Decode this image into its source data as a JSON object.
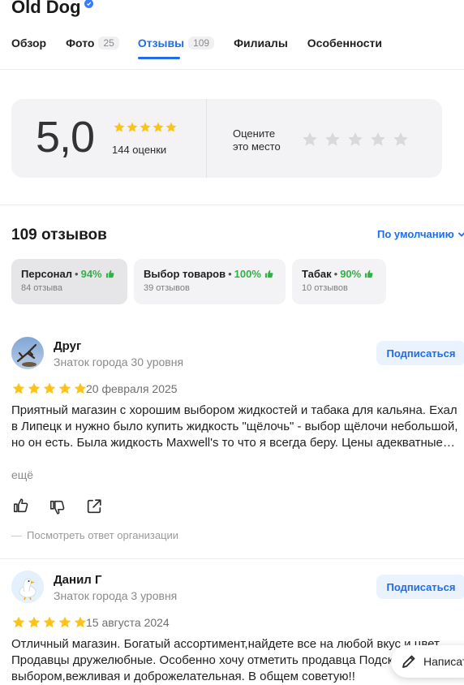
{
  "place": {
    "name": "Old Dog"
  },
  "tabs": [
    {
      "label": "Обзор",
      "count": ""
    },
    {
      "label": "Фото",
      "count": "25"
    },
    {
      "label": "Отзывы",
      "count": "109"
    },
    {
      "label": "Филиалы",
      "count": ""
    },
    {
      "label": "Особенности",
      "count": ""
    }
  ],
  "rating": {
    "score": "5,0",
    "stars_filled": 5,
    "count_label": "144 оценки",
    "rate_prompt_line1": "Оцените",
    "rate_prompt_line2": "это место"
  },
  "reviews_header": {
    "count_label": "109 отзывов",
    "sort_label": "По умолчанию"
  },
  "aspects": [
    {
      "name": "Персонал",
      "percent": "94%",
      "count_label": "84 отзыва"
    },
    {
      "name": "Выбор товаров",
      "percent": "100%",
      "count_label": "39 отзывов"
    },
    {
      "name": "Табак",
      "percent": "90%",
      "count_label": "10 отзывов"
    }
  ],
  "reviews": [
    {
      "author": "Друг",
      "level": "Знаток города 30 уровня",
      "subscribe_label": "Подписаться",
      "stars": 5,
      "date": "20 февраля 2025",
      "text": "Приятный магазин с хорошим выбором жидкостей и табака для кальяна. Ехал в Липецк и нужно было купить жидкость \"щёлочь\" - выбор щёлочи небольшой, но он есть. Была жидкость Maxwell's то что я всегда беру. Цены адекватные…",
      "more_label": "ещё",
      "org_answer_label": "Посмотреть ответ организации"
    },
    {
      "author": "Данил Г",
      "level": "Знаток города 3 уровня",
      "subscribe_label": "Подписаться",
      "stars": 5,
      "date": "15 августа 2024",
      "text": "Отличный магазин. Богатый ассортимент,найдете все на любой вкус и цвет. Продавцы дружелюбные. Особенно хочу отметить продавца Подсказала с выбором,вежливая и доброжелательная. В общем советую!!"
    }
  ],
  "write_button": {
    "label": "Написать"
  },
  "colors": {
    "accent": "#1f6ee6",
    "star": "#fcc419",
    "star_empty": "#d9d9dc",
    "positive": "#2fb344"
  }
}
